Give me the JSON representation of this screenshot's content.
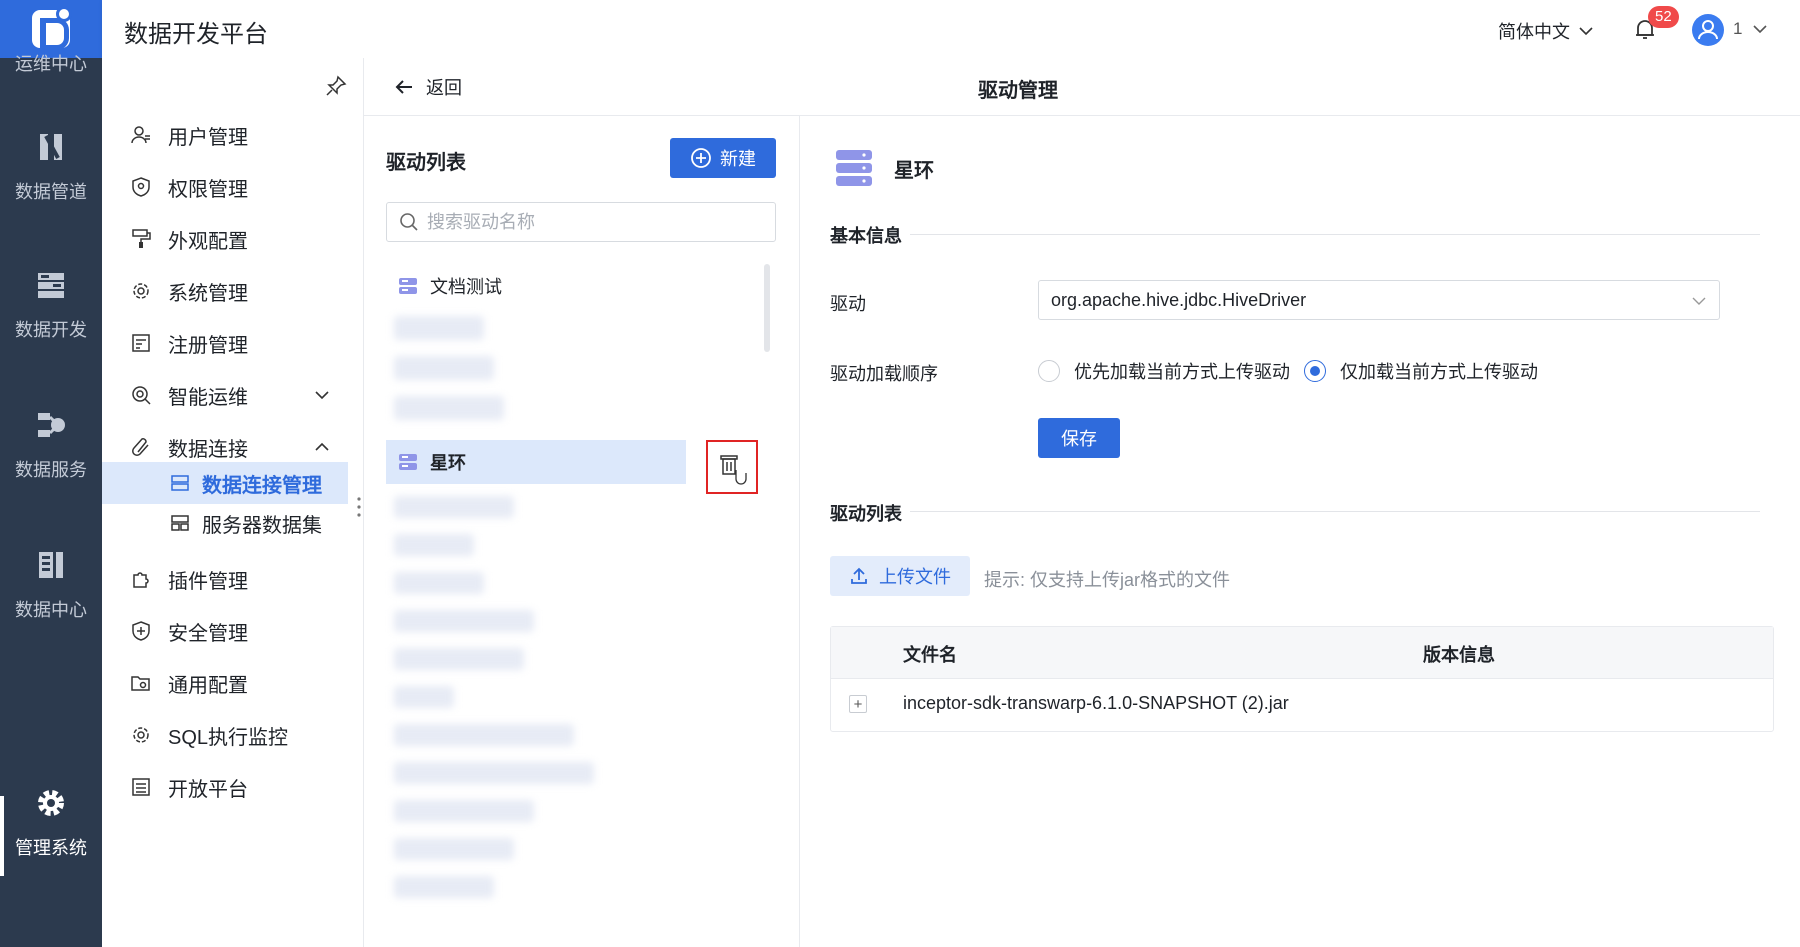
{
  "rail": {
    "cut_label": "运维中心",
    "items": [
      {
        "label": "数据管道",
        "icon": "pipeline-icon"
      },
      {
        "label": "数据开发",
        "icon": "develop-icon"
      },
      {
        "label": "数据服务",
        "icon": "service-icon"
      },
      {
        "label": "数据中心",
        "icon": "data-center-icon"
      },
      {
        "label": "管理系统",
        "icon": "gear-icon"
      }
    ],
    "active_index": 4
  },
  "header": {
    "app_title": "数据开发平台",
    "language": "简体中文",
    "notification_count": "52",
    "user": "1"
  },
  "sidemenu": {
    "items": [
      {
        "label": "用户管理",
        "icon": "user-icon"
      },
      {
        "label": "权限管理",
        "icon": "shield-icon"
      },
      {
        "label": "外观配置",
        "icon": "paint-roller-icon"
      },
      {
        "label": "系统管理",
        "icon": "gear-icon"
      },
      {
        "label": "注册管理",
        "icon": "register-icon"
      },
      {
        "label": "智能运维",
        "icon": "smart-ops-icon"
      },
      {
        "label": "数据连接",
        "icon": "link-icon"
      },
      {
        "label": "插件管理",
        "icon": "puzzle-icon"
      },
      {
        "label": "安全管理",
        "icon": "security-icon"
      },
      {
        "label": "通用配置",
        "icon": "folder-gear-icon"
      },
      {
        "label": "SQL执行监控",
        "icon": "monitor-icon"
      },
      {
        "label": "开放平台",
        "icon": "list-icon"
      }
    ],
    "sub_items": [
      {
        "label": "数据连接管理",
        "icon": "db-connection-icon",
        "active": true
      },
      {
        "label": "服务器数据集",
        "icon": "server-dataset-icon",
        "active": false
      }
    ]
  },
  "content": {
    "back_label": "返回",
    "page_title": "驱动管理"
  },
  "driver_list": {
    "title": "驱动列表",
    "new_label": "新建",
    "search_placeholder": "搜索驱动名称",
    "items": [
      {
        "label": "文档测试"
      },
      {
        "label": "星环",
        "selected": true
      }
    ]
  },
  "detail": {
    "name": "星环",
    "basic_info_title": "基本信息",
    "driver_label": "驱动",
    "driver_value": "org.apache.hive.jdbc.HiveDriver",
    "load_order_label": "驱动加载顺序",
    "load_options": [
      {
        "label": "优先加载当前方式上传驱动",
        "checked": false
      },
      {
        "label": "仅加载当前方式上传驱动",
        "checked": true
      }
    ],
    "save_label": "保存",
    "driver_list_title": "驱动列表",
    "upload_label": "上传文件",
    "upload_hint": "提示: 仅支持上传jar格式的文件",
    "table": {
      "columns": [
        "文件名",
        "版本信息"
      ],
      "rows": [
        {
          "expand": "+",
          "file": "inceptor-sdk-transwarp-6.1.0-SNAPSHOT (2).jar",
          "version": ""
        }
      ]
    }
  },
  "colors": {
    "primary": "#2f6bdc",
    "rail_bg": "#2c3a4e",
    "highlight": "#dce8fb",
    "danger": "#e02424"
  }
}
